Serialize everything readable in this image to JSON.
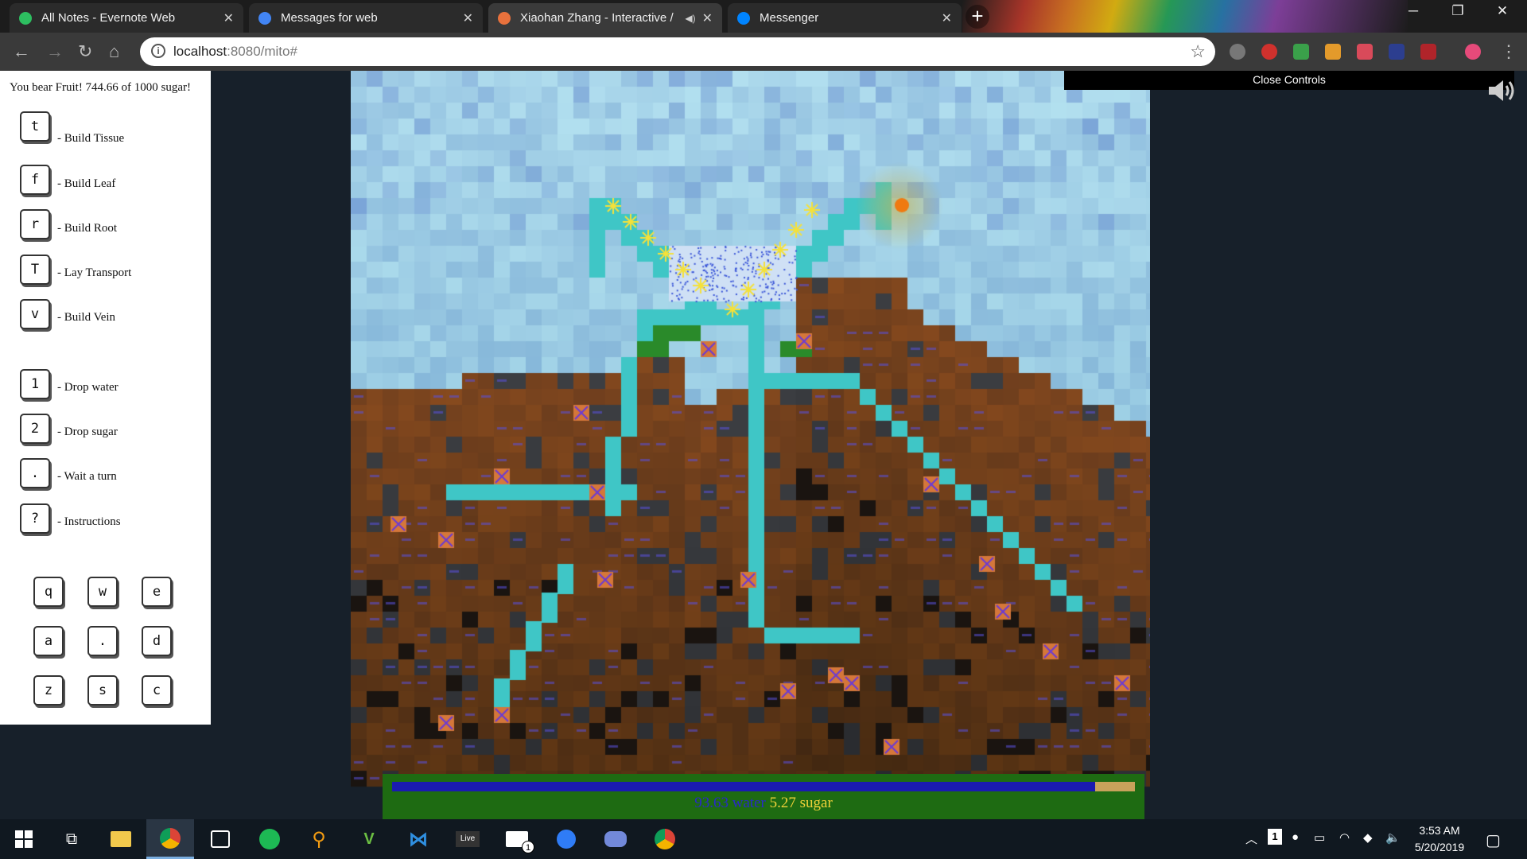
{
  "browser": {
    "tabs": [
      {
        "title": "All Notes - Evernote Web",
        "color": "#2dbe60"
      },
      {
        "title": "Messages for web",
        "color": "#4285f4"
      },
      {
        "title": "Xiaohan Zhang - Interactive /",
        "color": "#e8713c"
      },
      {
        "title": "Messenger",
        "color": "#0084ff"
      }
    ],
    "url_host": "localhost",
    "url_rest": ":8080/mito#"
  },
  "controls": {
    "status": "You bear Fruit! 744.66 of 1000 sugar!",
    "close_label": "Close Controls",
    "build_keys": [
      {
        "key": "t",
        "label": "- Build Tissue"
      },
      {
        "key": "f",
        "label": "- Build Leaf"
      },
      {
        "key": "r",
        "label": "- Build Root"
      },
      {
        "key": "T",
        "label": "- Lay Transport"
      },
      {
        "key": "v",
        "label": "- Build Vein"
      }
    ],
    "action_keys": [
      {
        "key": "1",
        "label": "- Drop water"
      },
      {
        "key": "2",
        "label": "- Drop sugar"
      },
      {
        "key": ".",
        "label": "- Wait a turn"
      },
      {
        "key": "?",
        "label": "- Instructions"
      }
    ],
    "move_keys": [
      "q",
      "w",
      "e",
      "a",
      ".",
      "d",
      "z",
      "s",
      "c"
    ]
  },
  "resources": {
    "water_value": "93.63",
    "water_label": " water ",
    "sugar_value": "5.27",
    "sugar_label": " sugar",
    "water_fraction": 0.9463,
    "colors": {
      "water": "#1a1ab0",
      "sugar": "#c8a25b",
      "panel": "#1e6b12"
    }
  },
  "taskbar": {
    "icons": [
      "windows-start-icon",
      "task-view-icon",
      "file-explorer-icon",
      "chrome-icon",
      "terminal-icon",
      "spotify-icon",
      "search-app-icon",
      "vim-icon",
      "vscode-icon",
      "ableton-live-icon",
      "mail-icon",
      "maps-icon",
      "discord-icon",
      "chrome-profile-icon"
    ],
    "mail_badge": "1",
    "tray_badge": "1",
    "time": "3:53 AM",
    "date": "5/20/2019"
  }
}
